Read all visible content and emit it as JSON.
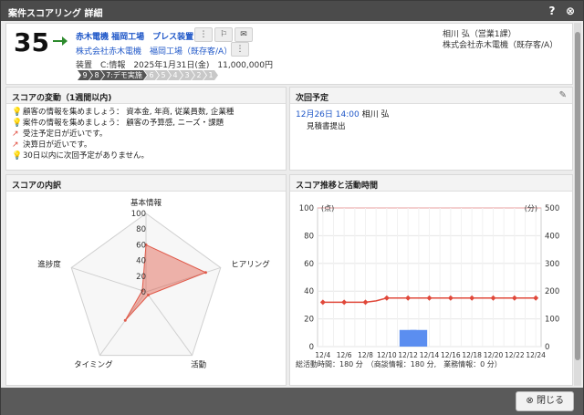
{
  "window": {
    "title": "案件スコアリング 詳細",
    "help": "?",
    "close": "⊗"
  },
  "header": {
    "score": "35",
    "deal_name": "赤木電機 福岡工場　プレス装置",
    "company_line": "株式会社赤木電機　福岡工場（既存客/A）",
    "product_line": "装置　C:情報　2025年1月31日(金)　11,000,000円",
    "owner": "相川 弘（営業1課）",
    "owner_company": "株式会社赤木電機（既存客/A）",
    "stages": [
      "9",
      "8",
      "7:デモ実施",
      "6",
      "5",
      "4",
      "3",
      "2",
      "1"
    ],
    "accent_color": "#2e8b2e"
  },
  "score_changes": {
    "title": "スコアの変動（1週間以内)",
    "items": [
      {
        "icon": "lightbulb-icon",
        "text": "顧客の情報を集めましょう： 資本金, 年商, 従業員数, 企業種"
      },
      {
        "icon": "lightbulb-icon",
        "text": "案件の情報を集めましょう： 顧客の予算感, ニーズ・課題"
      },
      {
        "icon": "trend-arrow-icon",
        "text": "受注予定日が近いです。"
      },
      {
        "icon": "trend-arrow-icon",
        "text": "決算日が近いです。"
      },
      {
        "icon": "lightbulb-icon",
        "text": "30日以内に次回予定がありません。"
      }
    ]
  },
  "next_schedule": {
    "title": "次回予定",
    "date": "12月26日 14:00",
    "person": "相川 弘",
    "task": "見積書提出"
  },
  "breakdown": {
    "title": "スコアの内訳",
    "axes": [
      "基本情報",
      "ヒアリング",
      "活動",
      "タイミング",
      "進捗度"
    ],
    "ticks": [
      "100",
      "80",
      "60",
      "40",
      "20",
      "0"
    ],
    "values": [
      60,
      80,
      5,
      45,
      5
    ],
    "color": "#e05a4a"
  },
  "trend": {
    "title": "スコア推移と活動時間",
    "left_unit": "(点)",
    "right_unit": "(分)",
    "left_ticks": [
      "100",
      "80",
      "60",
      "40",
      "20",
      "0"
    ],
    "right_ticks": [
      "500",
      "400",
      "300",
      "200",
      "100",
      "0"
    ],
    "summary": "総活動時間：180 分　（商談情報：180 分,　業務情報：0 分）"
  },
  "chart_data": {
    "type": "bar",
    "categories": [
      "12/4",
      "12/5",
      "12/6",
      "12/7",
      "12/8",
      "12/9",
      "12/10",
      "12/11",
      "12/12",
      "12/13",
      "12/14",
      "12/15",
      "12/16",
      "12/17",
      "12/18",
      "12/19",
      "12/20",
      "12/21",
      "12/22",
      "12/23",
      "12/24"
    ],
    "x_tick_labels": [
      "12/4",
      "12/6",
      "12/8",
      "12/10",
      "12/12",
      "12/14",
      "12/16",
      "12/18",
      "12/20",
      "12/22",
      "12/24"
    ],
    "series": [
      {
        "type": "line",
        "axis": "left",
        "color": "#e0483a",
        "values": [
          32,
          32,
          32,
          32,
          32,
          33,
          35,
          35,
          35,
          35,
          35,
          35,
          35,
          35,
          35,
          35,
          35,
          35,
          35,
          35,
          35
        ]
      },
      {
        "type": "bar",
        "axis": "right",
        "color": "#5b8ef0",
        "values": [
          0,
          0,
          0,
          0,
          0,
          0,
          0,
          0,
          60,
          60,
          0,
          0,
          0,
          0,
          0,
          0,
          0,
          0,
          0,
          0,
          0
        ]
      }
    ],
    "ylim_left": [
      0,
      100
    ],
    "ylim_right": [
      0,
      500
    ],
    "grid": true
  },
  "footer": {
    "close_label": "閉じる"
  }
}
